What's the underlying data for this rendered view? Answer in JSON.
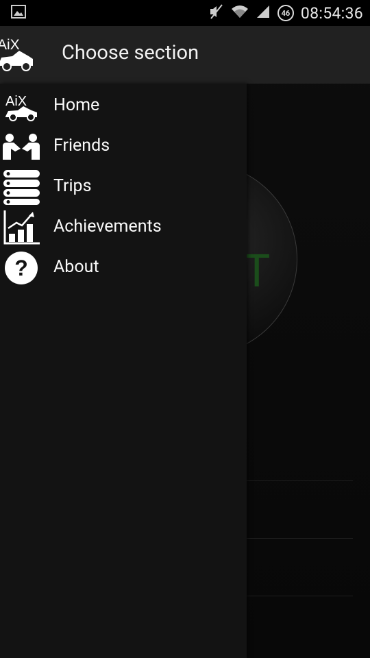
{
  "status_bar": {
    "time": "08:54:36",
    "network_badge": "46"
  },
  "action_bar": {
    "title": "Choose section",
    "logo_text": "AiX"
  },
  "drawer": {
    "items": [
      {
        "label": "Home",
        "icon": "car-logo-icon",
        "logo_text": "AiX"
      },
      {
        "label": "Friends",
        "icon": "handshake-icon"
      },
      {
        "label": "Trips",
        "icon": "list-icon"
      },
      {
        "label": "Achievements",
        "icon": "chart-icon"
      },
      {
        "label": "About",
        "icon": "question-icon"
      }
    ]
  },
  "background": {
    "disc_letter": "T"
  },
  "colors": {
    "drawer_bg": "#131313",
    "actionbar_bg": "#212121",
    "accent_green": "#1b4d1b"
  }
}
